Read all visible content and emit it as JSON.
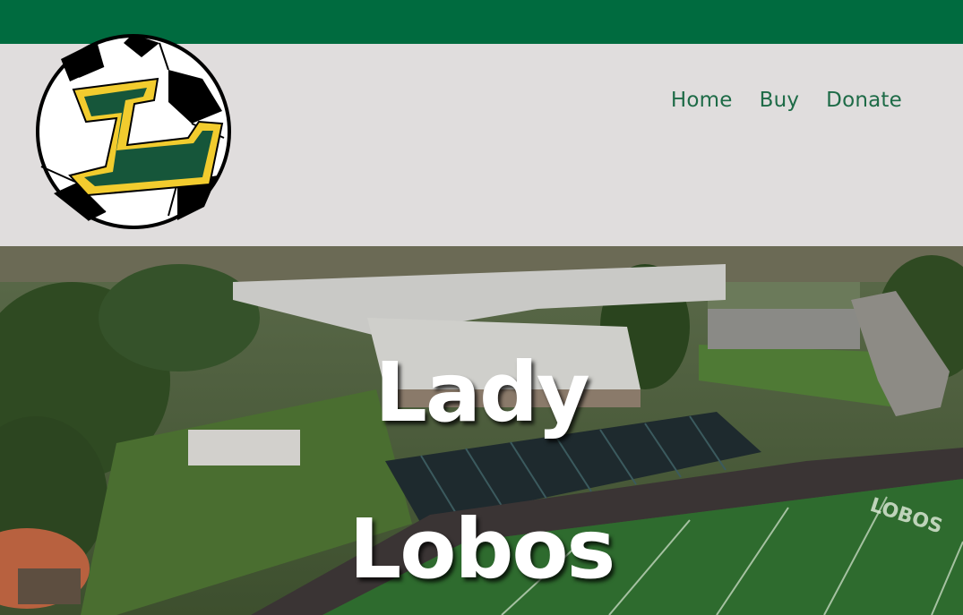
{
  "colors": {
    "brand_green": "#006b3f",
    "header_bg": "#e0dddd",
    "nav_text": "#1e6b47",
    "logo_gold": "#f2cc2e",
    "logo_green": "#16563a",
    "hero_text": "#ffffff"
  },
  "logo": {
    "icon": "soccer-ball-letter-l-logo",
    "letter": "L"
  },
  "nav": {
    "items": [
      "Home",
      "Buy",
      "Donate"
    ]
  },
  "hero": {
    "title_line1": "Lady",
    "title_line2": "Lobos",
    "background": "aerial-photo-school-campus-football-stadium",
    "field_marking_text": "LOBOS"
  }
}
